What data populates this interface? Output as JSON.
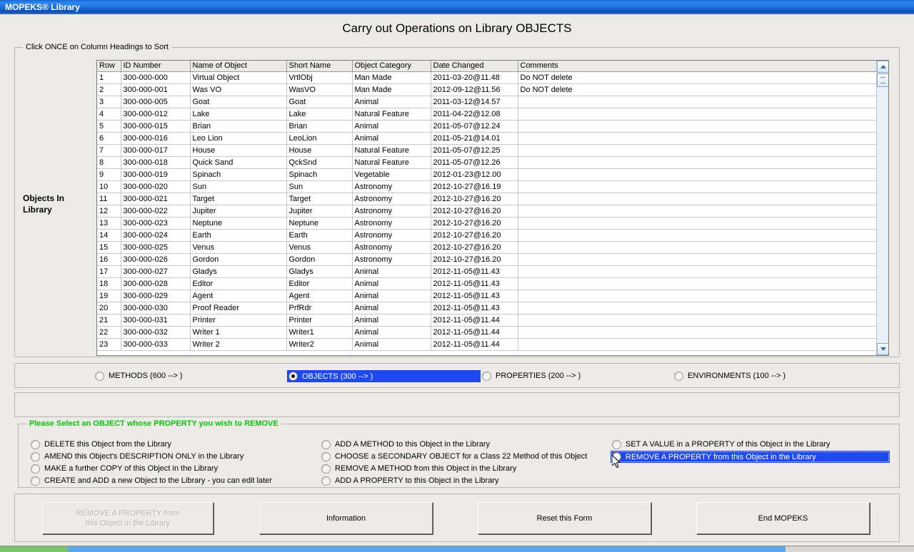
{
  "window": {
    "title": "MOPEKS® Library"
  },
  "page": {
    "title": "Carry out Operations on Library OBJECTS"
  },
  "grid_group": {
    "legend": "Click ONCE on Column Headings to Sort",
    "side_label": "Objects In Library"
  },
  "table": {
    "columns": [
      "Row",
      "ID Number",
      "Name of Object",
      "Short Name",
      "Object Category",
      "Date Changed",
      "Comments"
    ],
    "rows": [
      [
        "1",
        "300-000-000",
        "Virtual Object",
        "VrtlObj",
        "Man Made",
        "2011-03-20@11.48",
        "Do NOT delete"
      ],
      [
        "2",
        "300-000-001",
        "Was VO",
        "WasVO",
        "Man Made",
        "2012-09-12@11.56",
        "Do NOT delete"
      ],
      [
        "3",
        "300-000-005",
        "Goat",
        "Goat",
        "Animal",
        "2011-03-12@14.57",
        ""
      ],
      [
        "4",
        "300-000-012",
        "Lake",
        "Lake",
        "Natural Feature",
        "2011-04-22@12.08",
        ""
      ],
      [
        "5",
        "300-000-015",
        "Brian",
        "Brian",
        "Animal",
        "2011-05-07@12.24",
        ""
      ],
      [
        "6",
        "300-000-016",
        "Leo Lion",
        "LeoLion",
        "Animal",
        "2011-05-21@14.01",
        ""
      ],
      [
        "7",
        "300-000-017",
        "House",
        "House",
        "Natural Feature",
        "2011-05-07@12.25",
        ""
      ],
      [
        "8",
        "300-000-018",
        "Quick Sand",
        "QckSnd",
        "Natural Feature",
        "2011-05-07@12.26",
        ""
      ],
      [
        "9",
        "300-000-019",
        "Spinach",
        "Spinach",
        "Vegetable",
        "2012-01-23@12.00",
        ""
      ],
      [
        "10",
        "300-000-020",
        "Sun",
        "Sun",
        "Astronomy",
        "2012-10-27@16.19",
        ""
      ],
      [
        "11",
        "300-000-021",
        "Target",
        "Target",
        "Astronomy",
        "2012-10-27@16.20",
        ""
      ],
      [
        "12",
        "300-000-022",
        "Jupiter",
        "Jupiter",
        "Astronomy",
        "2012-10-27@16.20",
        ""
      ],
      [
        "13",
        "300-000-023",
        "Neptune",
        "Neptune",
        "Astronomy",
        "2012-10-27@16.20",
        ""
      ],
      [
        "14",
        "300-000-024",
        "Earth",
        "Earth",
        "Astronomy",
        "2012-10-27@16.20",
        ""
      ],
      [
        "15",
        "300-000-025",
        "Venus",
        "Venus",
        "Astronomy",
        "2012-10-27@16.20",
        ""
      ],
      [
        "16",
        "300-000-026",
        "Gordon",
        "Gordon",
        "Astronomy",
        "2012-10-27@16.20",
        ""
      ],
      [
        "17",
        "300-000-027",
        "Gladys",
        "Gladys",
        "Animal",
        "2012-11-05@11.43",
        ""
      ],
      [
        "18",
        "300-000-028",
        "Editor",
        "Editor",
        "Animal",
        "2012-11-05@11.43",
        ""
      ],
      [
        "19",
        "300-000-029",
        "Agent",
        "Agent",
        "Animal",
        "2012-11-05@11.43",
        ""
      ],
      [
        "20",
        "300-000-030",
        "Proof Reader",
        "PrfRdr",
        "Animal",
        "2012-11-05@11.43",
        ""
      ],
      [
        "21",
        "300-000-031",
        "Printer",
        "Printer",
        "Animal",
        "2012-11-05@11.44",
        ""
      ],
      [
        "22",
        "300-000-032",
        "Writer 1",
        "Writer1",
        "Animal",
        "2012-11-05@11.44",
        ""
      ],
      [
        "23",
        "300-000-033",
        "Writer 2",
        "Writer2",
        "Animal",
        "2012-11-05@11.44",
        ""
      ]
    ]
  },
  "type_radios": [
    {
      "label": "METHODS (600 --> )",
      "selected": false
    },
    {
      "label": "OBJECTS (300 --> )",
      "selected": true
    },
    {
      "label": "PROPERTIES (200 --> )",
      "selected": false
    },
    {
      "label": "ENVIRONMENTS (100 --> )",
      "selected": false
    }
  ],
  "action_group": {
    "legend": "Please Select an OBJECT whose PROPERTY you wish to REMOVE",
    "column1": [
      {
        "label": "DELETE this Object from the Library",
        "selected": false
      },
      {
        "label": "AMEND this Object's DESCRIPTION ONLY in the Library",
        "selected": false
      },
      {
        "label": "MAKE a further COPY of this Object in the Library",
        "selected": false
      },
      {
        "label": "CREATE and ADD a new Object to the Library - you can edit later",
        "selected": false
      }
    ],
    "column2": [
      {
        "label": "ADD A METHOD to this Object in the Library",
        "selected": false
      },
      {
        "label": "CHOOSE a SECONDARY OBJECT for a Class 22 Method of this Object",
        "selected": false
      },
      {
        "label": "REMOVE A METHOD from this Object in the Library",
        "selected": false
      },
      {
        "label": "ADD A PROPERTY to this Object in the Library",
        "selected": false
      }
    ],
    "column3": [
      {
        "label": "SET A VALUE in a PROPERTY of this Object in the Library",
        "selected": false
      },
      {
        "label": "REMOVE A PROPERTY from this Object in the Library",
        "selected": true
      }
    ]
  },
  "buttons": {
    "primary_line1": "REMOVE A PROPERTY from",
    "primary_line2": "this Object in the Library",
    "information": "Information",
    "reset": "Reset this Form",
    "end": "End MOPEKS"
  },
  "colors": {
    "selection_blue": "#1f49f0",
    "legend_green": "#0ac40a",
    "titlebar_blue": "#1767d6"
  }
}
